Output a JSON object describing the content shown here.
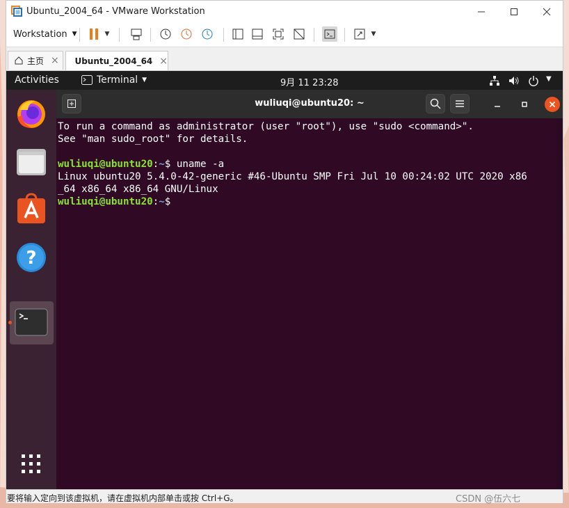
{
  "window": {
    "title": "Ubuntu_2004_64 - VMware Workstation"
  },
  "toolbar": {
    "menu_label": "Workstation",
    "icons": [
      "pause-icon",
      "send-ctrl-alt-del-icon",
      "snapshot-take-icon",
      "snapshot-revert-icon",
      "snapshot-manager-icon",
      "library-view-icon",
      "thumbnail-view-icon",
      "fit-guest-icon",
      "unity-icon",
      "console-view-icon",
      "fullscreen-icon"
    ]
  },
  "tabs": [
    {
      "label": "主页",
      "icon": "home-icon"
    },
    {
      "label": "Ubuntu_2004_64",
      "icon": "vm-icon",
      "active": true
    }
  ],
  "guest": {
    "topbar": {
      "activities": "Activities",
      "app_menu": "Terminal",
      "clock": "9月 11  23:28",
      "icons": [
        "network-icon",
        "volume-icon",
        "power-icon",
        "chevron-down-icon"
      ]
    },
    "dock": {
      "apps": [
        "firefox-icon",
        "files-icon",
        "software-center-icon",
        "help-icon",
        "terminal-icon"
      ],
      "show_apps": "app-grid-icon"
    },
    "terminal": {
      "title": "wuliuqi@ubuntu20: ~",
      "lines": {
        "l1": "To run a command as administrator (user \"root\"), use \"sudo <command>\".",
        "l2": "See \"man sudo_root\" for details.",
        "p1_user": "wuliuqi@ubuntu20",
        "p1_sep": ":",
        "p1_path": "~",
        "p1_cmd": "$ uname -a",
        "o1": "Linux ubuntu20 5.4.0-42-generic #46-Ubuntu SMP Fri Jul 10 00:24:02 UTC 2020 x86",
        "o2": "_64 x86_64 x86_64 GNU/Linux",
        "p2_user": "wuliuqi@ubuntu20",
        "p2_sep": ":",
        "p2_path": "~",
        "p2_cmd": "$ "
      }
    }
  },
  "statusbar": {
    "text": "要将输入定向到该虚拟机，请在虚拟机内部单击或按 Ctrl+G。",
    "watermark": "CSDN @伍六七"
  },
  "colors": {
    "ubuntu_aubergine": "#300a24",
    "prompt_green": "#8ae234",
    "path_blue": "#729fcf",
    "orange_accent": "#e95420"
  }
}
